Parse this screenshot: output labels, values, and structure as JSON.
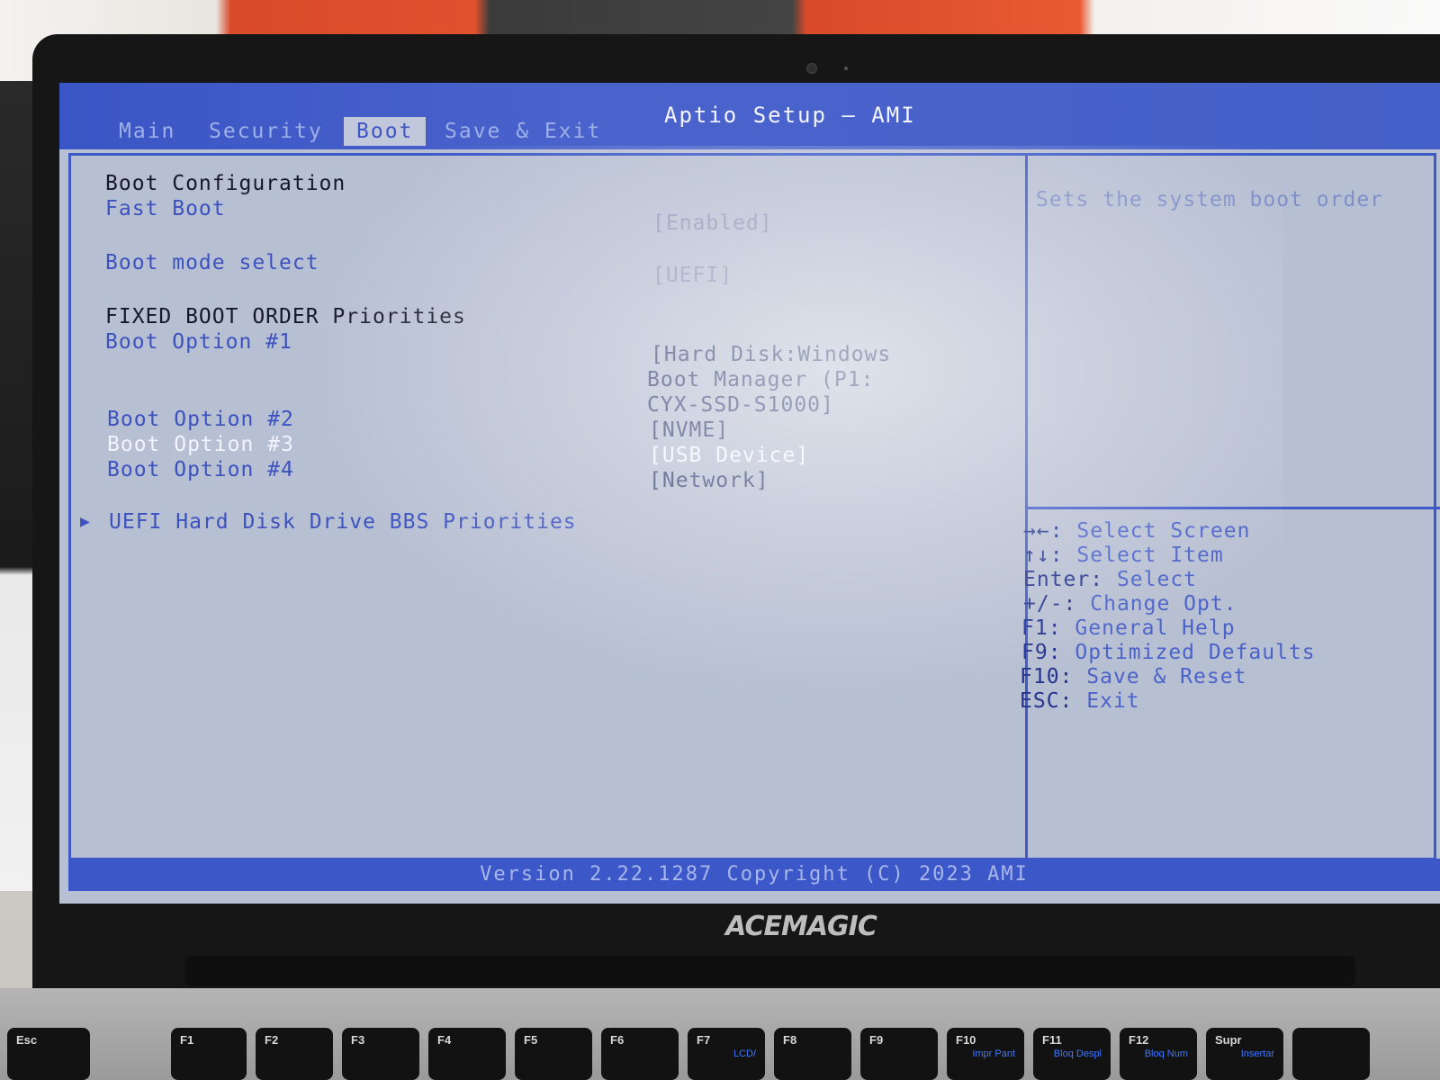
{
  "window": {
    "title": "Aptio Setup – AMI"
  },
  "tabs": [
    {
      "label": "Main",
      "active": false
    },
    {
      "label": "Security",
      "active": false
    },
    {
      "label": "Boot",
      "active": true
    },
    {
      "label": "Save & Exit",
      "active": false
    }
  ],
  "boot": {
    "config_header": "Boot Configuration",
    "fast_boot_label": "Fast Boot",
    "fast_boot_value": "[Enabled]",
    "boot_mode_label": "Boot mode select",
    "boot_mode_value": "[UEFI]",
    "fixed_order_header": "FIXED BOOT ORDER Priorities",
    "options": [
      {
        "label": "Boot Option #1",
        "value_lines": [
          "[Hard Disk:Windows",
          "Boot Manager (P1:",
          "CYX-SSD-S1000]"
        ]
      },
      {
        "label": "Boot Option #2",
        "value": "[NVME]"
      },
      {
        "label": "Boot Option #3",
        "value": "[USB Device]",
        "selected": true
      },
      {
        "label": "Boot Option #4",
        "value": "[Network]"
      }
    ],
    "submenu": "UEFI Hard Disk Drive BBS Priorities",
    "submenu_icon": "triangle-right-icon"
  },
  "help": {
    "text": "Sets the system boot order"
  },
  "keys": [
    {
      "key": "→←:",
      "desc": "Select Screen"
    },
    {
      "key": "↑↓:",
      "desc": "Select Item"
    },
    {
      "key": "Enter:",
      "desc": "Select"
    },
    {
      "key": "+/-:",
      "desc": "Change Opt."
    },
    {
      "key": "F1:",
      "desc": "General Help"
    },
    {
      "key": "F9:",
      "desc": "Optimized Defaults"
    },
    {
      "key": "F10:",
      "desc": "Save & Reset"
    },
    {
      "key": "ESC:",
      "desc": "Exit"
    }
  ],
  "footer": {
    "version": "Version 2.22.1287 Copyright (C) 2023 AMI"
  },
  "device": {
    "brand": "ACEMAGIC"
  },
  "keyboard": [
    {
      "label": "Esc",
      "sub": ""
    },
    {
      "label": "F1",
      "sub": ""
    },
    {
      "label": "F2",
      "sub": ""
    },
    {
      "label": "F3",
      "sub": ""
    },
    {
      "label": "F4",
      "sub": ""
    },
    {
      "label": "F5",
      "sub": ""
    },
    {
      "label": "F6",
      "sub": ""
    },
    {
      "label": "F7",
      "sub": "LCD/"
    },
    {
      "label": "F8",
      "sub": ""
    },
    {
      "label": "F9",
      "sub": ""
    },
    {
      "label": "F10",
      "sub": "Impr Pant"
    },
    {
      "label": "F11",
      "sub": "Bloq Despl"
    },
    {
      "label": "F12",
      "sub": "Bloq Num"
    },
    {
      "label": "Supr",
      "sub": "Insertar"
    }
  ],
  "colors": {
    "bios_blue": "#3f58c8",
    "bios_background": "#b7bfd2",
    "selected_text": "#f2f4ff"
  }
}
